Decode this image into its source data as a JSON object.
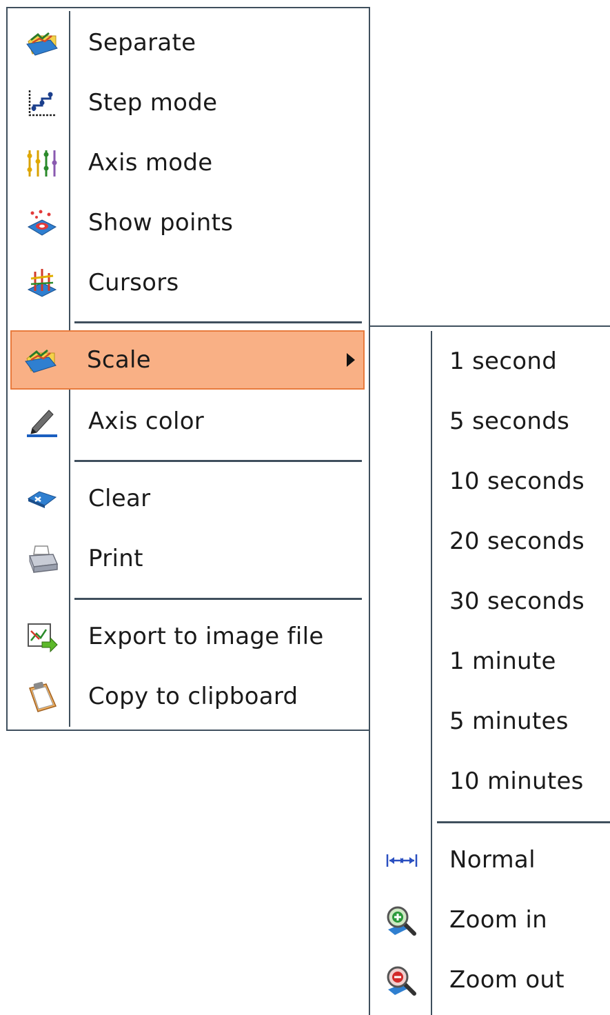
{
  "main_menu": {
    "items": [
      {
        "label": "Separate",
        "icon": "folder-chart-icon"
      },
      {
        "label": "Step mode",
        "icon": "step-chart-icon"
      },
      {
        "label": "Axis mode",
        "icon": "axis-bars-icon"
      },
      {
        "label": "Show points",
        "icon": "points-icon"
      },
      {
        "label": "Cursors",
        "icon": "cursors-icon"
      },
      {
        "label": "Scale",
        "icon": "folder-chart-icon",
        "selected": true,
        "has_submenu": true
      },
      {
        "label": "Axis color",
        "icon": "pencil-icon"
      },
      {
        "label": "Clear",
        "icon": "eraser-icon"
      },
      {
        "label": "Print",
        "icon": "printer-icon"
      },
      {
        "label": "Export to image file",
        "icon": "export-image-icon"
      },
      {
        "label": "Copy to clipboard",
        "icon": "clipboard-icon"
      }
    ]
  },
  "sub_menu": {
    "items": [
      {
        "label": "1 second"
      },
      {
        "label": "5 seconds"
      },
      {
        "label": "10 seconds"
      },
      {
        "label": "20 seconds"
      },
      {
        "label": "30 seconds"
      },
      {
        "label": "1 minute"
      },
      {
        "label": "5 minutes"
      },
      {
        "label": "10 minutes"
      },
      {
        "label": "Normal",
        "icon": "fit-width-icon"
      },
      {
        "label": "Zoom in",
        "icon": "zoom-in-icon"
      },
      {
        "label": "Zoom out",
        "icon": "zoom-out-icon"
      }
    ]
  },
  "colors": {
    "highlight_fill": "#f9b085",
    "highlight_border": "#e87a3c",
    "menu_border": "#3f4f5d"
  }
}
